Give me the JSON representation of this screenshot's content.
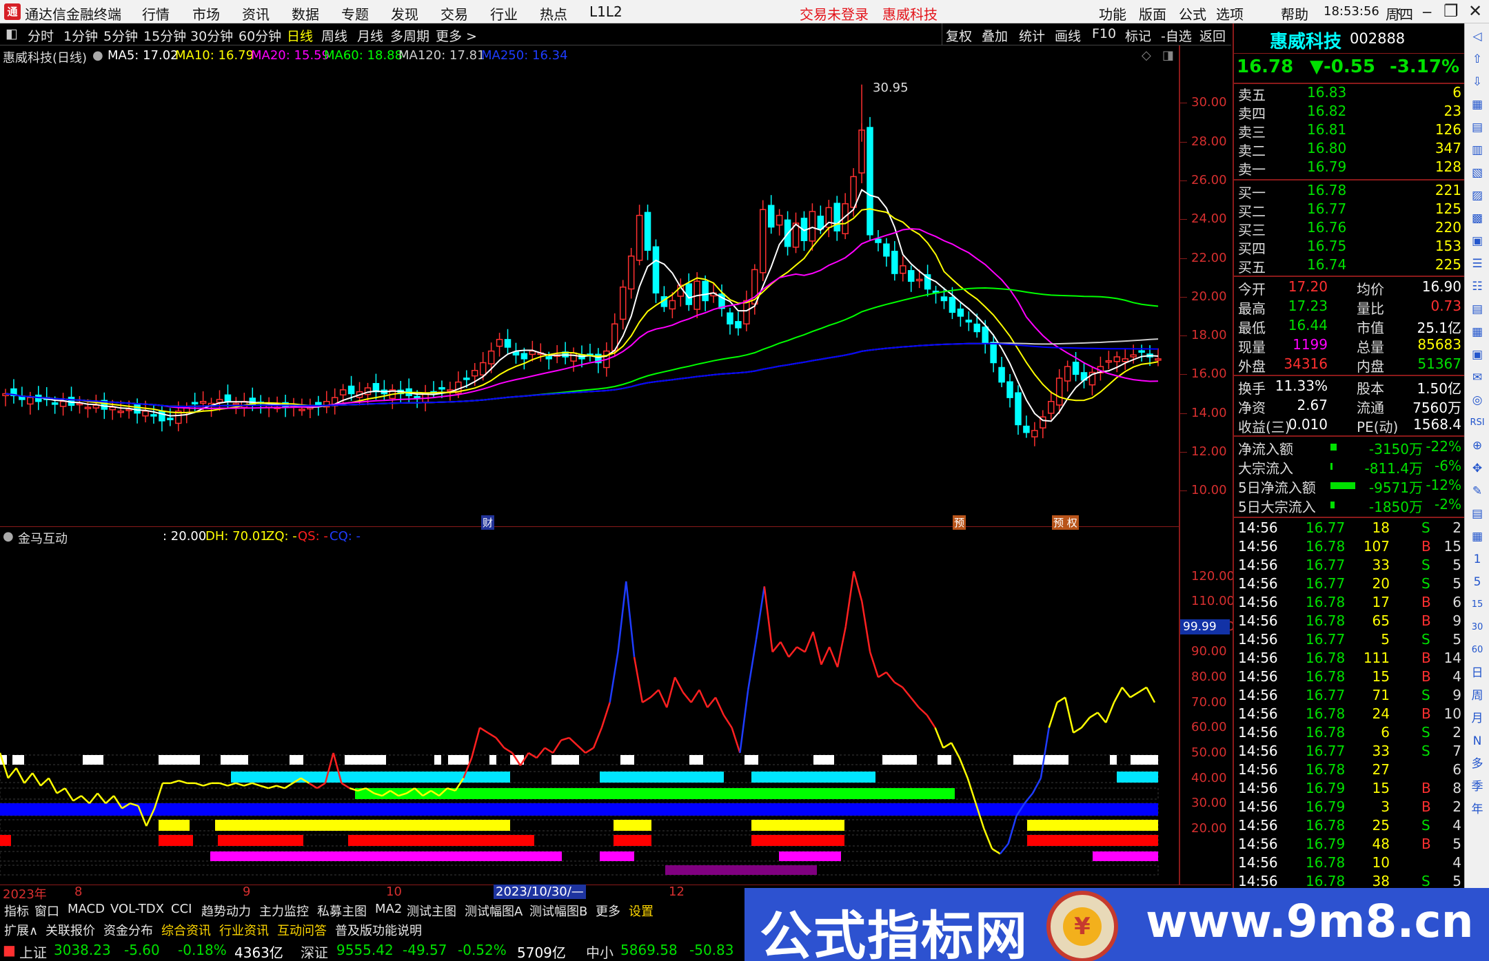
{
  "app": {
    "logo": "通",
    "title": "通达信金融终端"
  },
  "menu": [
    "行情",
    "市场",
    "资讯",
    "数据",
    "专题",
    "发现",
    "交易",
    "行业",
    "热点",
    "L1L2"
  ],
  "notices": {
    "trade": "交易未登录",
    "stock": "惠威科技"
  },
  "right_menu": [
    "功能",
    "版面",
    "公式",
    "选项",
    "帮助"
  ],
  "clock": "18:53:56",
  "weekday": "周四",
  "win_controls": {
    "back": "‹",
    "min": "─",
    "max": "❐",
    "close": "✕"
  },
  "periods": [
    "分时",
    "1分钟",
    "5分钟",
    "15分钟",
    "30分钟",
    "60分钟",
    "日线",
    "周线",
    "月线",
    "多周期",
    "更多 >"
  ],
  "active_period": "日线",
  "toolbar_right": [
    "复权",
    "叠加",
    "统计",
    "画线",
    "F10",
    "标记",
    "-自选",
    "返回"
  ],
  "ma_line": {
    "stock": "惠威科技(日线)",
    "ma5": "MA5: 17.02",
    "ma10": "MA10: 16.79",
    "ma20": "MA20: 15.59",
    "ma60": "MA60: 18.88",
    "ma120": "MA120: 17.81",
    "ma250": "MA250: 16.34"
  },
  "colors": {
    "ma5": "#ffffff",
    "ma10": "#ffff00",
    "ma20": "#ff00ff",
    "ma60": "#00ff00",
    "ma120": "#cccccc",
    "ma250": "#0000ff",
    "up": "#ff3030",
    "down": "#00ffff",
    "axis": "#d62f2f"
  },
  "main_y_ticks": [
    "30.00",
    "28.00",
    "26.00",
    "24.00",
    "22.00",
    "20.00",
    "18.00",
    "16.00",
    "14.00",
    "12.00",
    "10.00"
  ],
  "peak_label": "30.95",
  "event_markers": [
    "财",
    "预",
    "预 权"
  ],
  "sub": {
    "name": "金马互动",
    "v1": ": 20.00",
    "dh": "DH: 70.01",
    "zq": "ZQ: -",
    "qs": "QS: -",
    "cq": "CQ: -",
    "y_ticks": [
      "120.00",
      "110.00",
      "100.00",
      "90.00",
      "80.00",
      "70.00",
      "60.00",
      "50.00",
      "40.00",
      "30.00",
      "20.00"
    ],
    "current_tag": "99.99"
  },
  "chart_data": {
    "type": "line",
    "name": "金马互动",
    "ylim": [
      0,
      130
    ],
    "values": [
      50,
      40,
      44,
      38,
      42,
      37,
      40,
      34,
      36,
      31,
      33,
      30,
      34,
      30,
      33,
      28,
      30,
      29,
      21,
      28,
      38,
      38,
      39,
      38,
      38,
      37,
      38,
      38,
      37,
      38,
      37,
      38,
      37,
      36,
      37,
      36,
      38,
      40,
      38,
      36,
      38,
      50,
      38,
      36,
      35,
      36,
      34,
      33,
      35,
      33,
      34,
      36,
      33,
      35,
      33,
      36,
      35,
      40,
      48,
      60,
      58,
      56,
      52,
      50,
      45,
      50,
      48,
      52,
      50,
      55,
      56,
      53,
      50,
      52,
      60,
      70,
      90,
      118,
      88,
      70,
      72,
      75,
      68,
      80,
      74,
      70,
      75,
      68,
      72,
      65,
      60,
      50,
      75,
      95,
      116,
      90,
      94,
      88,
      92,
      90,
      98,
      85,
      92,
      84,
      100,
      122,
      110,
      90,
      80,
      82,
      78,
      76,
      72,
      68,
      65,
      60,
      52,
      54,
      48,
      40,
      30,
      20,
      12,
      10,
      14,
      25,
      30,
      34,
      40,
      60,
      70,
      72,
      58,
      60,
      64,
      66,
      62,
      70,
      76,
      72,
      74,
      76,
      70
    ]
  },
  "dates": [
    "2023年",
    "8",
    "9",
    "10",
    "2023/10/30/—",
    "12"
  ],
  "tabs1": [
    "指标",
    "窗口",
    "MACD",
    "VOL-TDX",
    "CCI",
    "趋势动力",
    "主力监控",
    "私募主图",
    "MA2",
    "测试主图",
    "测试幅图A",
    "测试幅图B",
    "更多",
    "设置"
  ],
  "tabs2": [
    "扩展∧",
    "关联报价",
    "资金分布",
    "综合资讯",
    "行业资讯",
    "互动问答",
    "普及版功能说明"
  ],
  "status": [
    {
      "name": "上证",
      "price": "3038.23",
      "chg": "-5.60",
      "pct": "-0.18%",
      "amt": "4363亿"
    },
    {
      "name": "深证",
      "price": "9555.42",
      "chg": "-49.57",
      "pct": "-0.52%",
      "amt": "5709亿"
    },
    {
      "name": "中小",
      "price": "5869.58",
      "chg": "-50.83",
      "pct": "",
      "amt": ""
    }
  ],
  "quote": {
    "name": "惠威科技",
    "code": "002888",
    "price": "16.78",
    "change": "▼-0.55",
    "pct": "-3.17%",
    "asks": [
      {
        "label": "卖五",
        "price": "16.83",
        "vol": "6"
      },
      {
        "label": "卖四",
        "price": "16.82",
        "vol": "23"
      },
      {
        "label": "卖三",
        "price": "16.81",
        "vol": "126"
      },
      {
        "label": "卖二",
        "price": "16.80",
        "vol": "347"
      },
      {
        "label": "卖一",
        "price": "16.79",
        "vol": "128"
      }
    ],
    "bids": [
      {
        "label": "买一",
        "price": "16.78",
        "vol": "221"
      },
      {
        "label": "买二",
        "price": "16.77",
        "vol": "125"
      },
      {
        "label": "买三",
        "price": "16.76",
        "vol": "220"
      },
      {
        "label": "买四",
        "price": "16.75",
        "vol": "153"
      },
      {
        "label": "买五",
        "price": "16.74",
        "vol": "225"
      }
    ],
    "stats": [
      {
        "l1": "今开",
        "v1": "17.20",
        "l2": "均价",
        "v2": "16.90"
      },
      {
        "l1": "最高",
        "v1": "17.23",
        "l2": "量比",
        "v2": "0.73"
      },
      {
        "l1": "最低",
        "v1": "16.44",
        "l2": "市值",
        "v2": "25.1亿"
      },
      {
        "l1": "现量",
        "v1": "1199",
        "l2": "总量",
        "v2": "85683"
      },
      {
        "l1": "外盘",
        "v1": "34316",
        "l2": "内盘",
        "v2": "51367"
      }
    ],
    "fund": [
      {
        "l1": "换手",
        "v1": "11.33%",
        "l2": "股本",
        "v2": "1.50亿"
      },
      {
        "l1": "净资",
        "v1": "2.67",
        "l2": "流通",
        "v2": "7560万"
      },
      {
        "l1": "收益(三)",
        "v1": "0.010",
        "l2": "PE(动)",
        "v2": "1568.4"
      }
    ],
    "flow": [
      {
        "label": "净流入额",
        "val": "-3150万",
        "pct": "-22%",
        "bar": 0.22
      },
      {
        "label": "大宗流入",
        "val": "-811.4万",
        "pct": "-6%",
        "bar": 0.06
      },
      {
        "label": "5日净流入额",
        "val": "-9571万",
        "pct": "-12%",
        "bar": 0.9
      },
      {
        "label": "5日大宗流入",
        "val": "-1850万",
        "pct": "-2%",
        "bar": 0.15
      }
    ],
    "ticks": [
      {
        "t": "14:56",
        "p": "16.77",
        "v": "18",
        "s": "S",
        "n": "2"
      },
      {
        "t": "14:56",
        "p": "16.78",
        "v": "107",
        "s": "B",
        "n": "15"
      },
      {
        "t": "14:56",
        "p": "16.77",
        "v": "33",
        "s": "S",
        "n": "5"
      },
      {
        "t": "14:56",
        "p": "16.77",
        "v": "20",
        "s": "S",
        "n": "5"
      },
      {
        "t": "14:56",
        "p": "16.78",
        "v": "17",
        "s": "B",
        "n": "6"
      },
      {
        "t": "14:56",
        "p": "16.78",
        "v": "65",
        "s": "B",
        "n": "9"
      },
      {
        "t": "14:56",
        "p": "16.77",
        "v": "5",
        "s": "S",
        "n": "5"
      },
      {
        "t": "14:56",
        "p": "16.78",
        "v": "111",
        "s": "B",
        "n": "14"
      },
      {
        "t": "14:56",
        "p": "16.78",
        "v": "15",
        "s": "B",
        "n": "4"
      },
      {
        "t": "14:56",
        "p": "16.77",
        "v": "71",
        "s": "S",
        "n": "9"
      },
      {
        "t": "14:56",
        "p": "16.78",
        "v": "24",
        "s": "B",
        "n": "10"
      },
      {
        "t": "14:56",
        "p": "16.78",
        "v": "6",
        "s": "S",
        "n": "2"
      },
      {
        "t": "14:56",
        "p": "16.77",
        "v": "33",
        "s": "S",
        "n": "7"
      },
      {
        "t": "14:56",
        "p": "16.78",
        "v": "27",
        "s": "",
        "n": "6"
      },
      {
        "t": "14:56",
        "p": "16.79",
        "v": "15",
        "s": "B",
        "n": "8"
      },
      {
        "t": "14:56",
        "p": "16.79",
        "v": "3",
        "s": "B",
        "n": "2"
      },
      {
        "t": "14:56",
        "p": "16.78",
        "v": "25",
        "s": "S",
        "n": "4"
      },
      {
        "t": "14:56",
        "p": "16.79",
        "v": "48",
        "s": "B",
        "n": "5"
      },
      {
        "t": "14:56",
        "p": "16.78",
        "v": "10",
        "s": "",
        "n": "4"
      },
      {
        "t": "14:56",
        "p": "16.78",
        "v": "38",
        "s": "S",
        "n": "5"
      }
    ]
  },
  "side_icons": [
    "◁",
    "⇧",
    "⇩",
    "▦",
    "▤",
    "▥",
    "▧",
    "▨",
    "▩",
    "▣",
    "☰",
    "☷",
    "▤",
    "▦",
    "▣",
    "✉",
    "◎",
    "RSI",
    "⊕",
    "✥",
    "✎",
    "▤",
    "▦",
    "1",
    "5",
    "15",
    "30",
    "60",
    "日",
    "周",
    "月",
    "N",
    "多",
    "季",
    "年"
  ],
  "banner": {
    "text": "公式指标网",
    "url": "www.9m8.cn",
    "medal": "¥"
  }
}
